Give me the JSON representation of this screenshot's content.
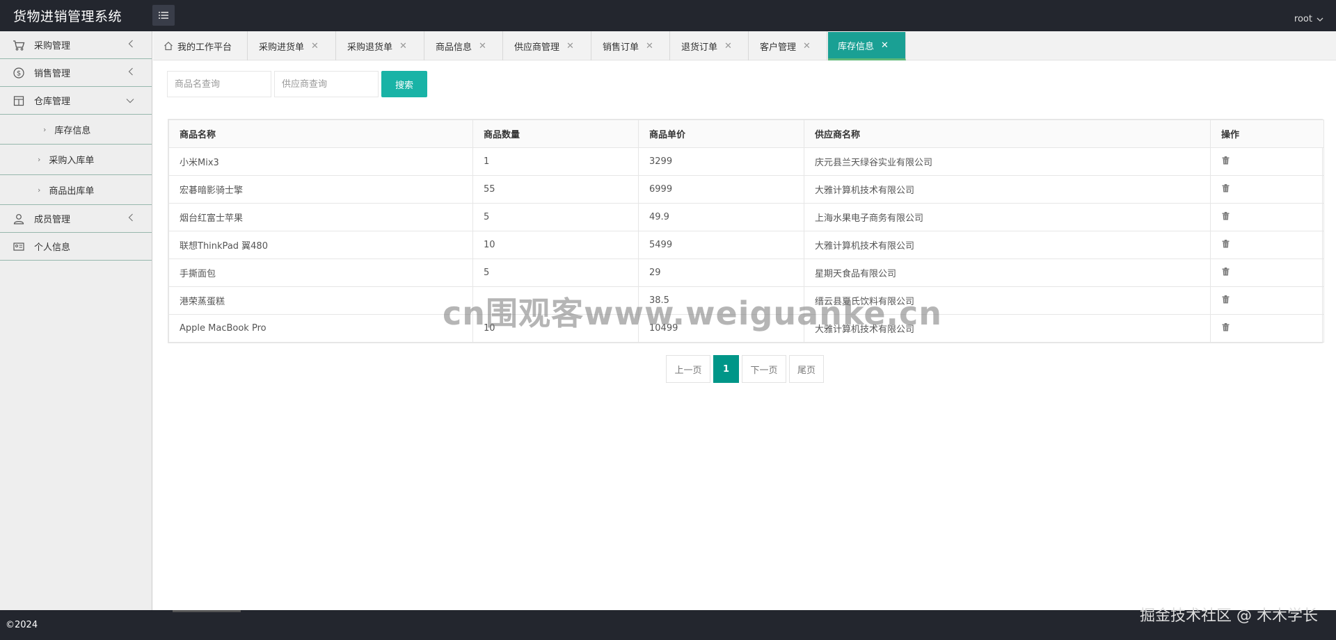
{
  "app": {
    "title": "货物进销管理系统",
    "user": "root"
  },
  "sidebar": {
    "items": [
      {
        "label": "采购管理"
      },
      {
        "label": "销售管理"
      },
      {
        "label": "仓库管理"
      },
      {
        "label": "成员管理"
      },
      {
        "label": "个人信息"
      }
    ],
    "subitems": [
      {
        "label": "库存信息"
      },
      {
        "label": "采购入库单"
      },
      {
        "label": "商品出库单"
      }
    ]
  },
  "tabs": [
    {
      "label": "我的工作平台"
    },
    {
      "label": "采购进货单"
    },
    {
      "label": "采购退货单"
    },
    {
      "label": "商品信息"
    },
    {
      "label": "供应商管理"
    },
    {
      "label": "销售订单"
    },
    {
      "label": "退货订单"
    },
    {
      "label": "客户管理"
    },
    {
      "label": "库存信息"
    }
  ],
  "search": {
    "product_placeholder": "商品名查询",
    "supplier_placeholder": "供应商查询",
    "button_label": "搜索"
  },
  "table": {
    "headers": [
      "商品名称",
      "商品数量",
      "商品单价",
      "供应商名称",
      "操作"
    ],
    "rows": [
      [
        "小米Mix3",
        "1",
        "3299",
        "庆元县兰天绿谷实业有限公司"
      ],
      [
        "宏碁暗影骑士擎",
        "55",
        "6999",
        "大雅计算机技术有限公司"
      ],
      [
        "烟台红富士苹果",
        "5",
        "49.9",
        "上海水果电子商务有限公司"
      ],
      [
        "联想ThinkPad 翼480",
        "10",
        "5499",
        "大雅计算机技术有限公司"
      ],
      [
        "手撕面包",
        "5",
        "29",
        "星期天食品有限公司"
      ],
      [
        "港荣蒸蛋糕",
        "",
        "38.5",
        "缙云县夏氏饮料有限公司"
      ],
      [
        "Apple MacBook Pro",
        "10",
        "10499",
        "大雅计算机技术有限公司"
      ]
    ]
  },
  "pagination": {
    "prev": "上一页",
    "current": "1",
    "next": "下一页",
    "last": "尾页"
  },
  "watermark": "cn围观客www.weiguanke.cn",
  "footer": {
    "copyright": "©2024",
    "community": "掘金技术社区 @ 木木学长"
  }
}
